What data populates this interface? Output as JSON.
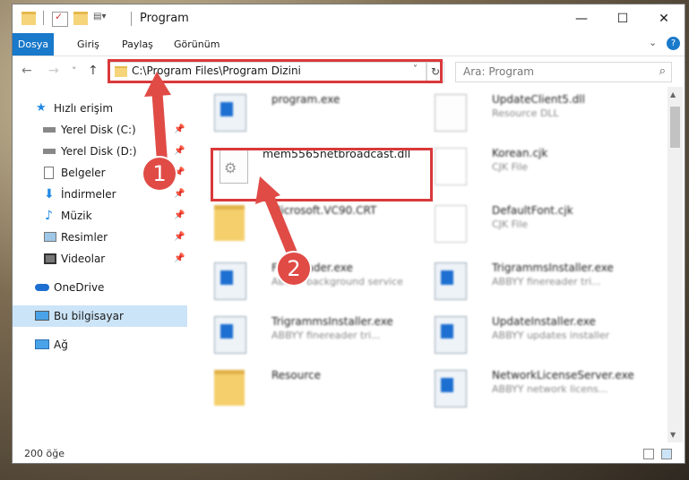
{
  "window": {
    "title": "Program",
    "controls": {
      "minimize": "—",
      "maximize": "☐",
      "close": "✕"
    }
  },
  "ribbon": {
    "tabs": [
      "Dosya",
      "Giriş",
      "Paylaş",
      "Görünüm"
    ],
    "expand_icon": "chevron-down-icon",
    "help": "?"
  },
  "nav": {
    "back": "←",
    "forward": "→",
    "recent": "˅",
    "up": "↑",
    "address": "C:\\Program Files\\Program Dizini",
    "address_dropdown": "˅",
    "refresh": "↻",
    "search_placeholder": "Ara: Program",
    "search_icon": "⌕"
  },
  "sidebar": {
    "items": [
      {
        "label": "Hızlı erişim",
        "icon": "star-icon",
        "pinned": false
      },
      {
        "label": "Yerel Disk (C:)",
        "icon": "drive-icon",
        "pinned": true
      },
      {
        "label": "Yerel Disk (D:)",
        "icon": "drive-icon",
        "pinned": true
      },
      {
        "label": "Belgeler",
        "icon": "documents-icon",
        "pinned": true
      },
      {
        "label": "İndirmeler",
        "icon": "download-icon",
        "pinned": true
      },
      {
        "label": "Müzik",
        "icon": "music-icon",
        "pinned": true
      },
      {
        "label": "Resimler",
        "icon": "pictures-icon",
        "pinned": true
      },
      {
        "label": "Videolar",
        "icon": "video-icon",
        "pinned": true
      },
      {
        "label": "OneDrive",
        "icon": "cloud-icon",
        "pinned": false
      },
      {
        "label": "Bu bilgisayar",
        "icon": "computer-icon",
        "pinned": false
      },
      {
        "label": "Ağ",
        "icon": "network-icon",
        "pinned": false
      }
    ]
  },
  "files": [
    {
      "name": "program.exe",
      "desc": "",
      "icon": "exe-icon"
    },
    {
      "name": "UpdateClient5.dll",
      "desc": "Resource DLL",
      "icon": "dll-icon"
    },
    {
      "name": "mem5565netbroadcast.dll",
      "desc": "",
      "icon": "dll-icon"
    },
    {
      "name": "Korean.cjk",
      "desc": "CJK File",
      "icon": "file-icon"
    },
    {
      "name": "Microsoft.VC90.CRT",
      "desc": "",
      "icon": "folder-icon"
    },
    {
      "name": "DefaultFont.cjk",
      "desc": "CJK File",
      "icon": "file-icon"
    },
    {
      "name": "FineReader.exe",
      "desc": "ABBYY background service",
      "icon": "exe-icon"
    },
    {
      "name": "TrigrammsInstaller.exe",
      "desc": "ABBYY finereader tri...",
      "icon": "exe-icon"
    },
    {
      "name": "TrigrammsInstaller.exe",
      "desc": "ABBYY finereader tri...",
      "icon": "exe-icon"
    },
    {
      "name": "UpdateInstaller.exe",
      "desc": "ABBYY updates installer",
      "icon": "exe-icon"
    },
    {
      "name": "Resource",
      "desc": "",
      "icon": "folder-icon"
    },
    {
      "name": "NetworkLicenseServer.exe",
      "desc": "ABBYY network licens...",
      "icon": "exe-icon"
    }
  ],
  "status": {
    "count": "200 öğe"
  },
  "annotations": {
    "step1": "1",
    "step2": "2",
    "color": "#e04b46"
  }
}
